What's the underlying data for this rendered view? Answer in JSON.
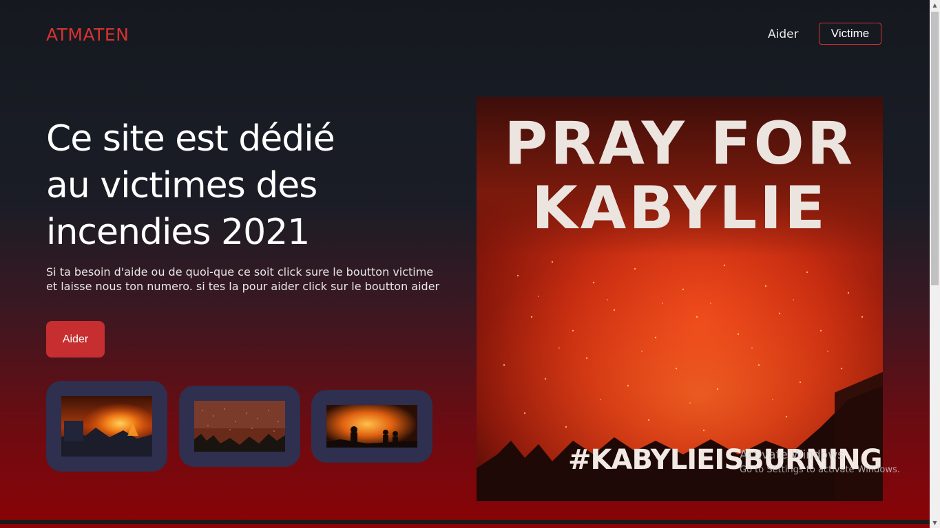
{
  "header": {
    "logo": "ATMATEN",
    "nav": {
      "aider": "Aider",
      "victime": "Victime"
    }
  },
  "hero": {
    "title_lines": [
      "Ce site est dédié",
      "au victimes des",
      "incendies 2021"
    ],
    "description_lines": [
      "Si ta besoin d'aide ou de quoi-que ce soit click sure le boutton victime",
      "et laisse nous ton numero. si tes la pour aider click sur le boutton aider"
    ],
    "cta": "Aider"
  },
  "thumbnails": [
    {
      "icon": "wildfire-hillside-photo"
    },
    {
      "icon": "embers-trees-photo"
    },
    {
      "icon": "silhouettes-fire-photo"
    }
  ],
  "feature_image": {
    "line1": "PRAY FOR",
    "line2": "KABYLIE",
    "hashtag": "#KABYLIEISBURNING"
  },
  "watermark": {
    "title": "Activate Windows",
    "subtitle": "Go to Settings to activate Windows."
  },
  "colors": {
    "accent": "#d7322f",
    "button": "#c72e30",
    "card": "#2f2f4f",
    "bg_top": "#15191f",
    "bg_bottom": "#8a0306"
  }
}
